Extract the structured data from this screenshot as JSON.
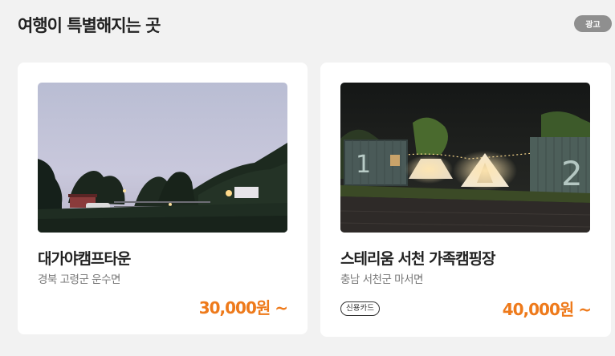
{
  "section": {
    "title": "여행이 특별해지는 곳",
    "ad_label": "광고"
  },
  "cards": [
    {
      "name": "대가야캠프타운",
      "location": "경북 고령군 운수면",
      "price": "30,000원 ~",
      "image": "camp-dusk-photo"
    },
    {
      "name": "스테리움 서천 가족캠핑장",
      "location": "충남 서천군 마서면",
      "price": "40,000원 ~",
      "tag": "신용카드",
      "image": "camp-night-tents-photo",
      "photo_numbers": [
        "1",
        "2"
      ]
    }
  ],
  "colors": {
    "price": "#ee7a1b",
    "ad_badge": "#8f8f8f"
  }
}
